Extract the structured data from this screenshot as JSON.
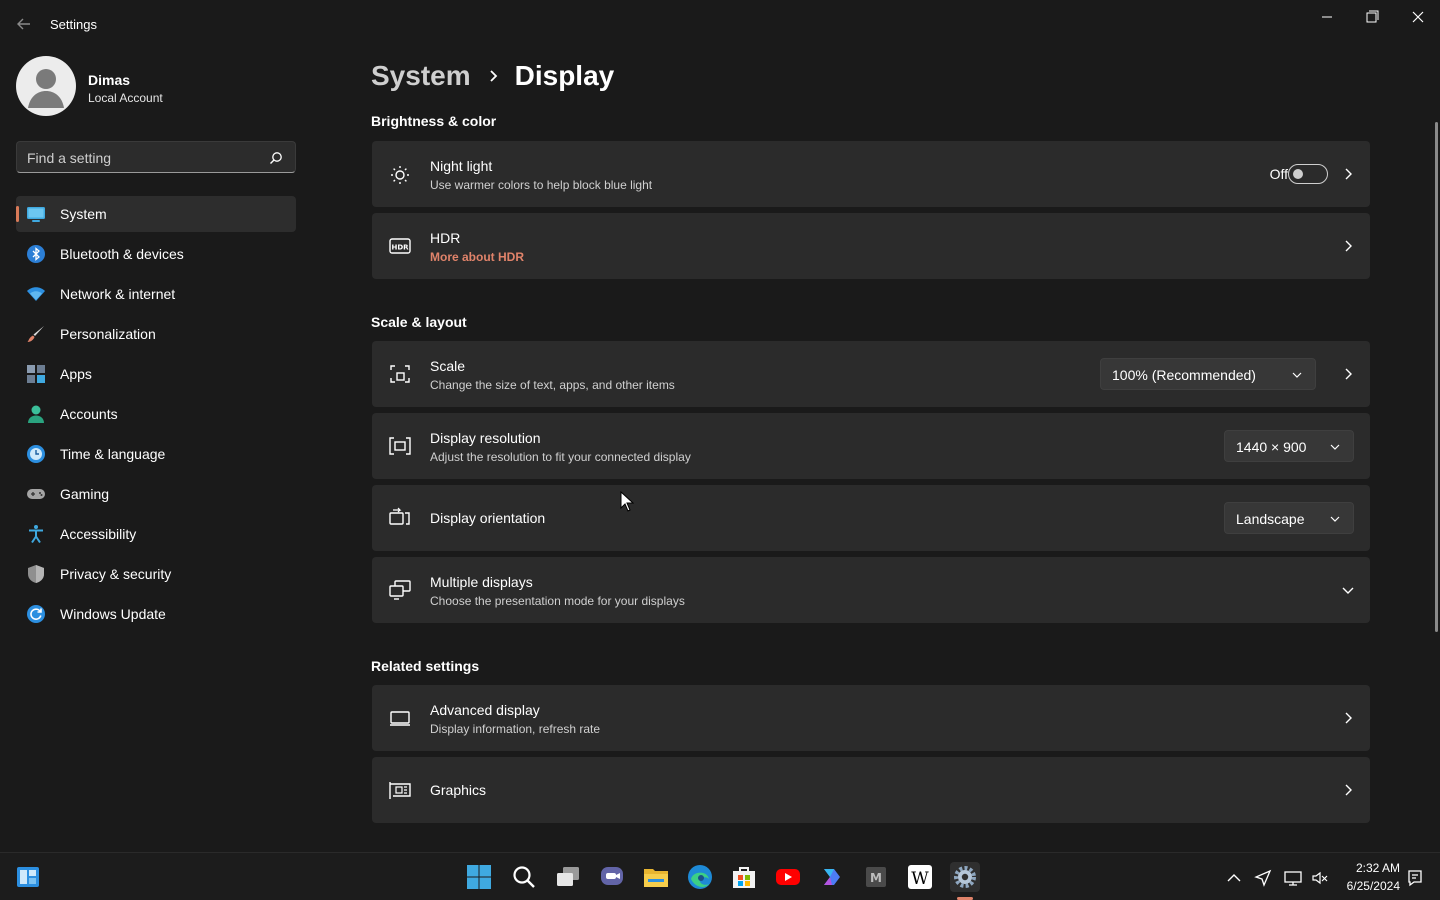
{
  "window": {
    "title": "Settings"
  },
  "profile": {
    "name": "Dimas",
    "account_type": "Local Account"
  },
  "search": {
    "placeholder": "Find a setting"
  },
  "sidebar": {
    "items": [
      {
        "label": "System",
        "icon": "system-icon",
        "active": true
      },
      {
        "label": "Bluetooth & devices",
        "icon": "bluetooth-icon"
      },
      {
        "label": "Network & internet",
        "icon": "wifi-icon"
      },
      {
        "label": "Personalization",
        "icon": "brush-icon"
      },
      {
        "label": "Apps",
        "icon": "apps-icon"
      },
      {
        "label": "Accounts",
        "icon": "accounts-icon"
      },
      {
        "label": "Time & language",
        "icon": "clock-globe-icon"
      },
      {
        "label": "Gaming",
        "icon": "gamepad-icon"
      },
      {
        "label": "Accessibility",
        "icon": "accessibility-icon"
      },
      {
        "label": "Privacy & security",
        "icon": "shield-icon"
      },
      {
        "label": "Windows Update",
        "icon": "refresh-icon"
      }
    ]
  },
  "breadcrumb": {
    "parent": "System",
    "current": "Display"
  },
  "sections": {
    "brightness": "Brightness & color",
    "scale_layout": "Scale & layout",
    "related": "Related settings"
  },
  "cards": {
    "night_light": {
      "title": "Night light",
      "subtitle": "Use warmer colors to help block blue light",
      "state_label": "Off",
      "enabled": false
    },
    "hdr": {
      "title": "HDR",
      "link": "More about HDR"
    },
    "scale": {
      "title": "Scale",
      "subtitle": "Change the size of text, apps, and other items",
      "value": "100% (Recommended)"
    },
    "resolution": {
      "title": "Display resolution",
      "subtitle": "Adjust the resolution to fit your connected display",
      "value": "1440 × 900"
    },
    "orientation": {
      "title": "Display orientation",
      "value": "Landscape"
    },
    "multiple": {
      "title": "Multiple displays",
      "subtitle": "Choose the presentation mode for your displays"
    },
    "advanced": {
      "title": "Advanced display",
      "subtitle": "Display information, refresh rate"
    },
    "graphics": {
      "title": "Graphics"
    }
  },
  "taskbar": {
    "apps": [
      "start-icon",
      "search-icon",
      "task-view-icon",
      "chat-icon",
      "file-explorer-icon",
      "edge-icon",
      "store-icon",
      "youtube-icon",
      "copilot-icon",
      "medium-icon",
      "wikipedia-icon",
      "settings-icon"
    ],
    "clock": {
      "time": "2:32 AM",
      "date": "6/25/2024"
    }
  },
  "colors": {
    "accent": "#d87a58",
    "link": "#e0836a",
    "card_bg": "#2b2b2b",
    "window_bg": "#1a1a1a"
  }
}
